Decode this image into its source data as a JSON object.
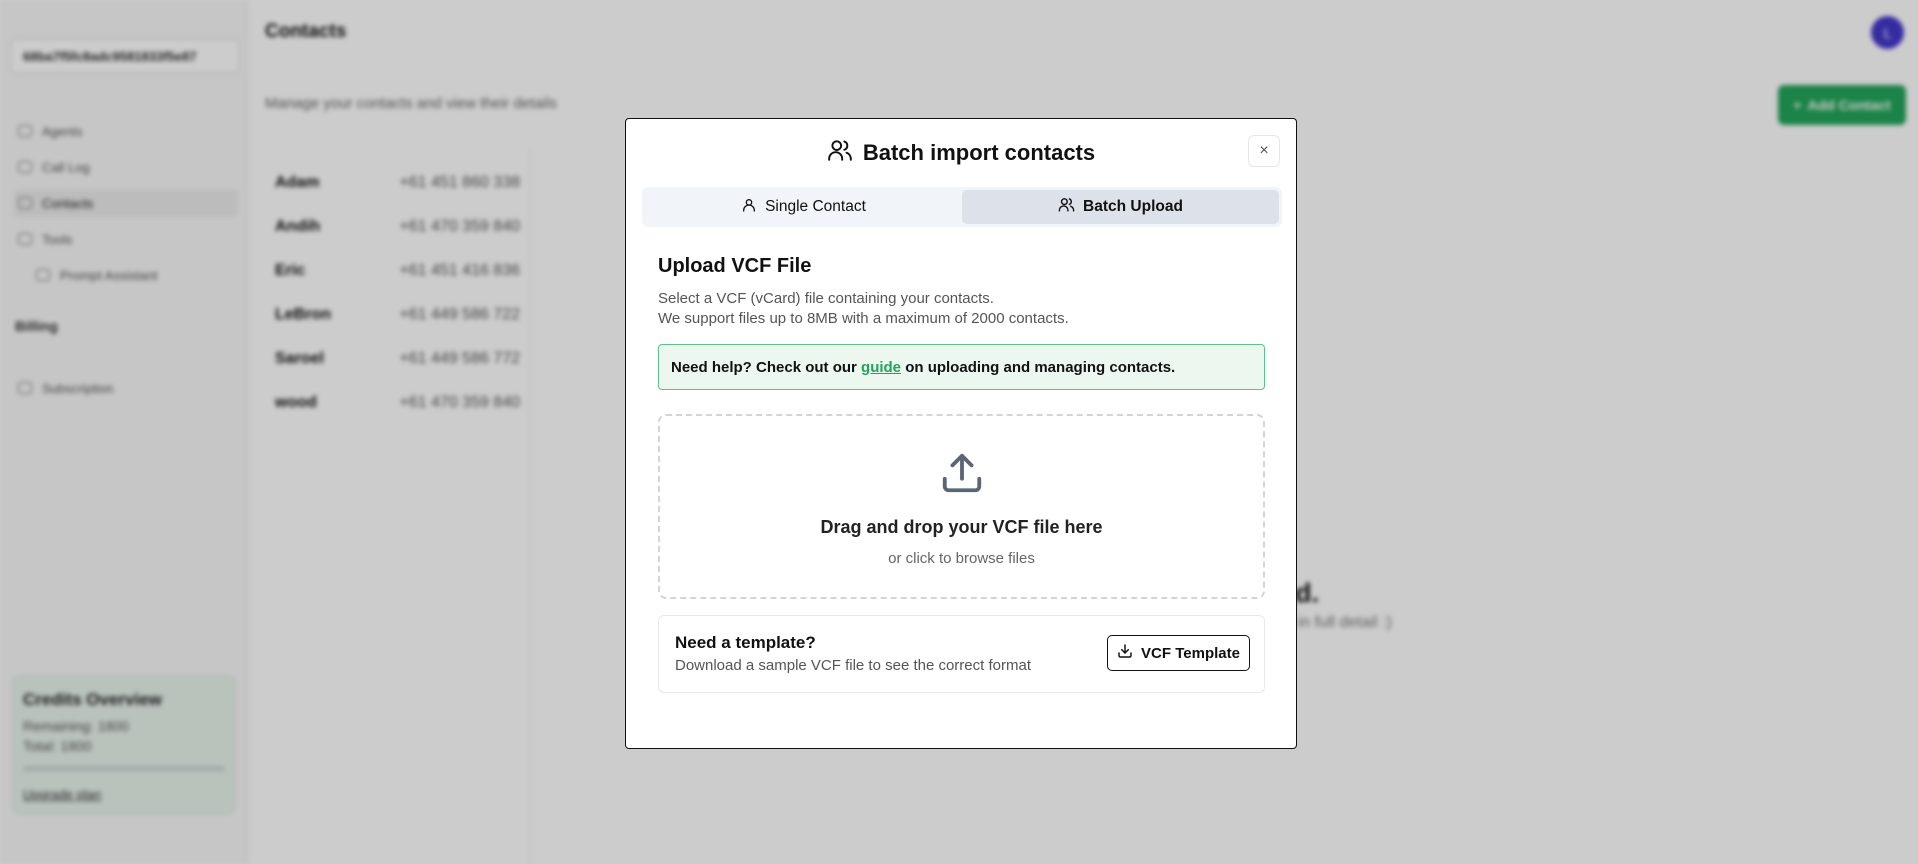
{
  "app": {
    "project_selector": "68ba7f5fc8adc9581833f5e87",
    "nav": [
      {
        "label": "Agents",
        "icon": "agents-icon"
      },
      {
        "label": "Call Log",
        "icon": "call-log-icon"
      },
      {
        "label": "Contacts",
        "icon": "contacts-icon"
      },
      {
        "label": "Tools",
        "icon": "tools-icon"
      },
      {
        "label": "Prompt Assistant",
        "icon": "prompt-icon"
      }
    ],
    "billing_label": "Billing",
    "subscription_label": "Subscription",
    "credits": {
      "title": "Credits Overview",
      "remaining": "Remaining: 1800",
      "total": "Total: 1800",
      "upgrade": "Upgrade plan"
    },
    "page_title": "Contacts",
    "page_subtitle": "Manage your contacts and view their details",
    "add_contact": "Add Contact",
    "avatar_initial": "L",
    "contacts": [
      {
        "name": "Adam",
        "phone": "+61 451 860 338"
      },
      {
        "name": "Andih",
        "phone": "+61 470 359 840"
      },
      {
        "name": "Eric",
        "phone": "+61 451 416 836"
      },
      {
        "name": "LeBron",
        "phone": "+61 449 586 722"
      },
      {
        "name": "Saroel",
        "phone": "+61 449 586 772"
      },
      {
        "name": "wood",
        "phone": "+61 470 359 840"
      }
    ],
    "empty_state_title": "cted.",
    "empty_state_sub": "hem in full detail :)"
  },
  "modal": {
    "title": "Batch import contacts",
    "close": "×",
    "tabs": [
      {
        "label": "Single Contact",
        "active": false
      },
      {
        "label": "Batch Upload",
        "active": true
      }
    ],
    "heading": "Upload VCF File",
    "desc_line1": "Select a VCF (vCard) file containing your contacts.",
    "desc_line2": "We support files up to 8MB with a maximum of 2000 contacts.",
    "help_prefix": "Need help? Check out our ",
    "help_link": "guide",
    "help_suffix": " on uploading and managing contacts.",
    "dropzone_title": "Drag and drop your VCF file here",
    "dropzone_sub": "or click to browse files",
    "template_title": "Need a template?",
    "template_sub": "Download a sample VCF file to see the correct format",
    "template_button": "VCF Template"
  },
  "colors": {
    "accent_green": "#22a55a",
    "help_border": "#5cc28a",
    "help_bg": "#ecf7ef",
    "avatar": "#4338ca"
  }
}
